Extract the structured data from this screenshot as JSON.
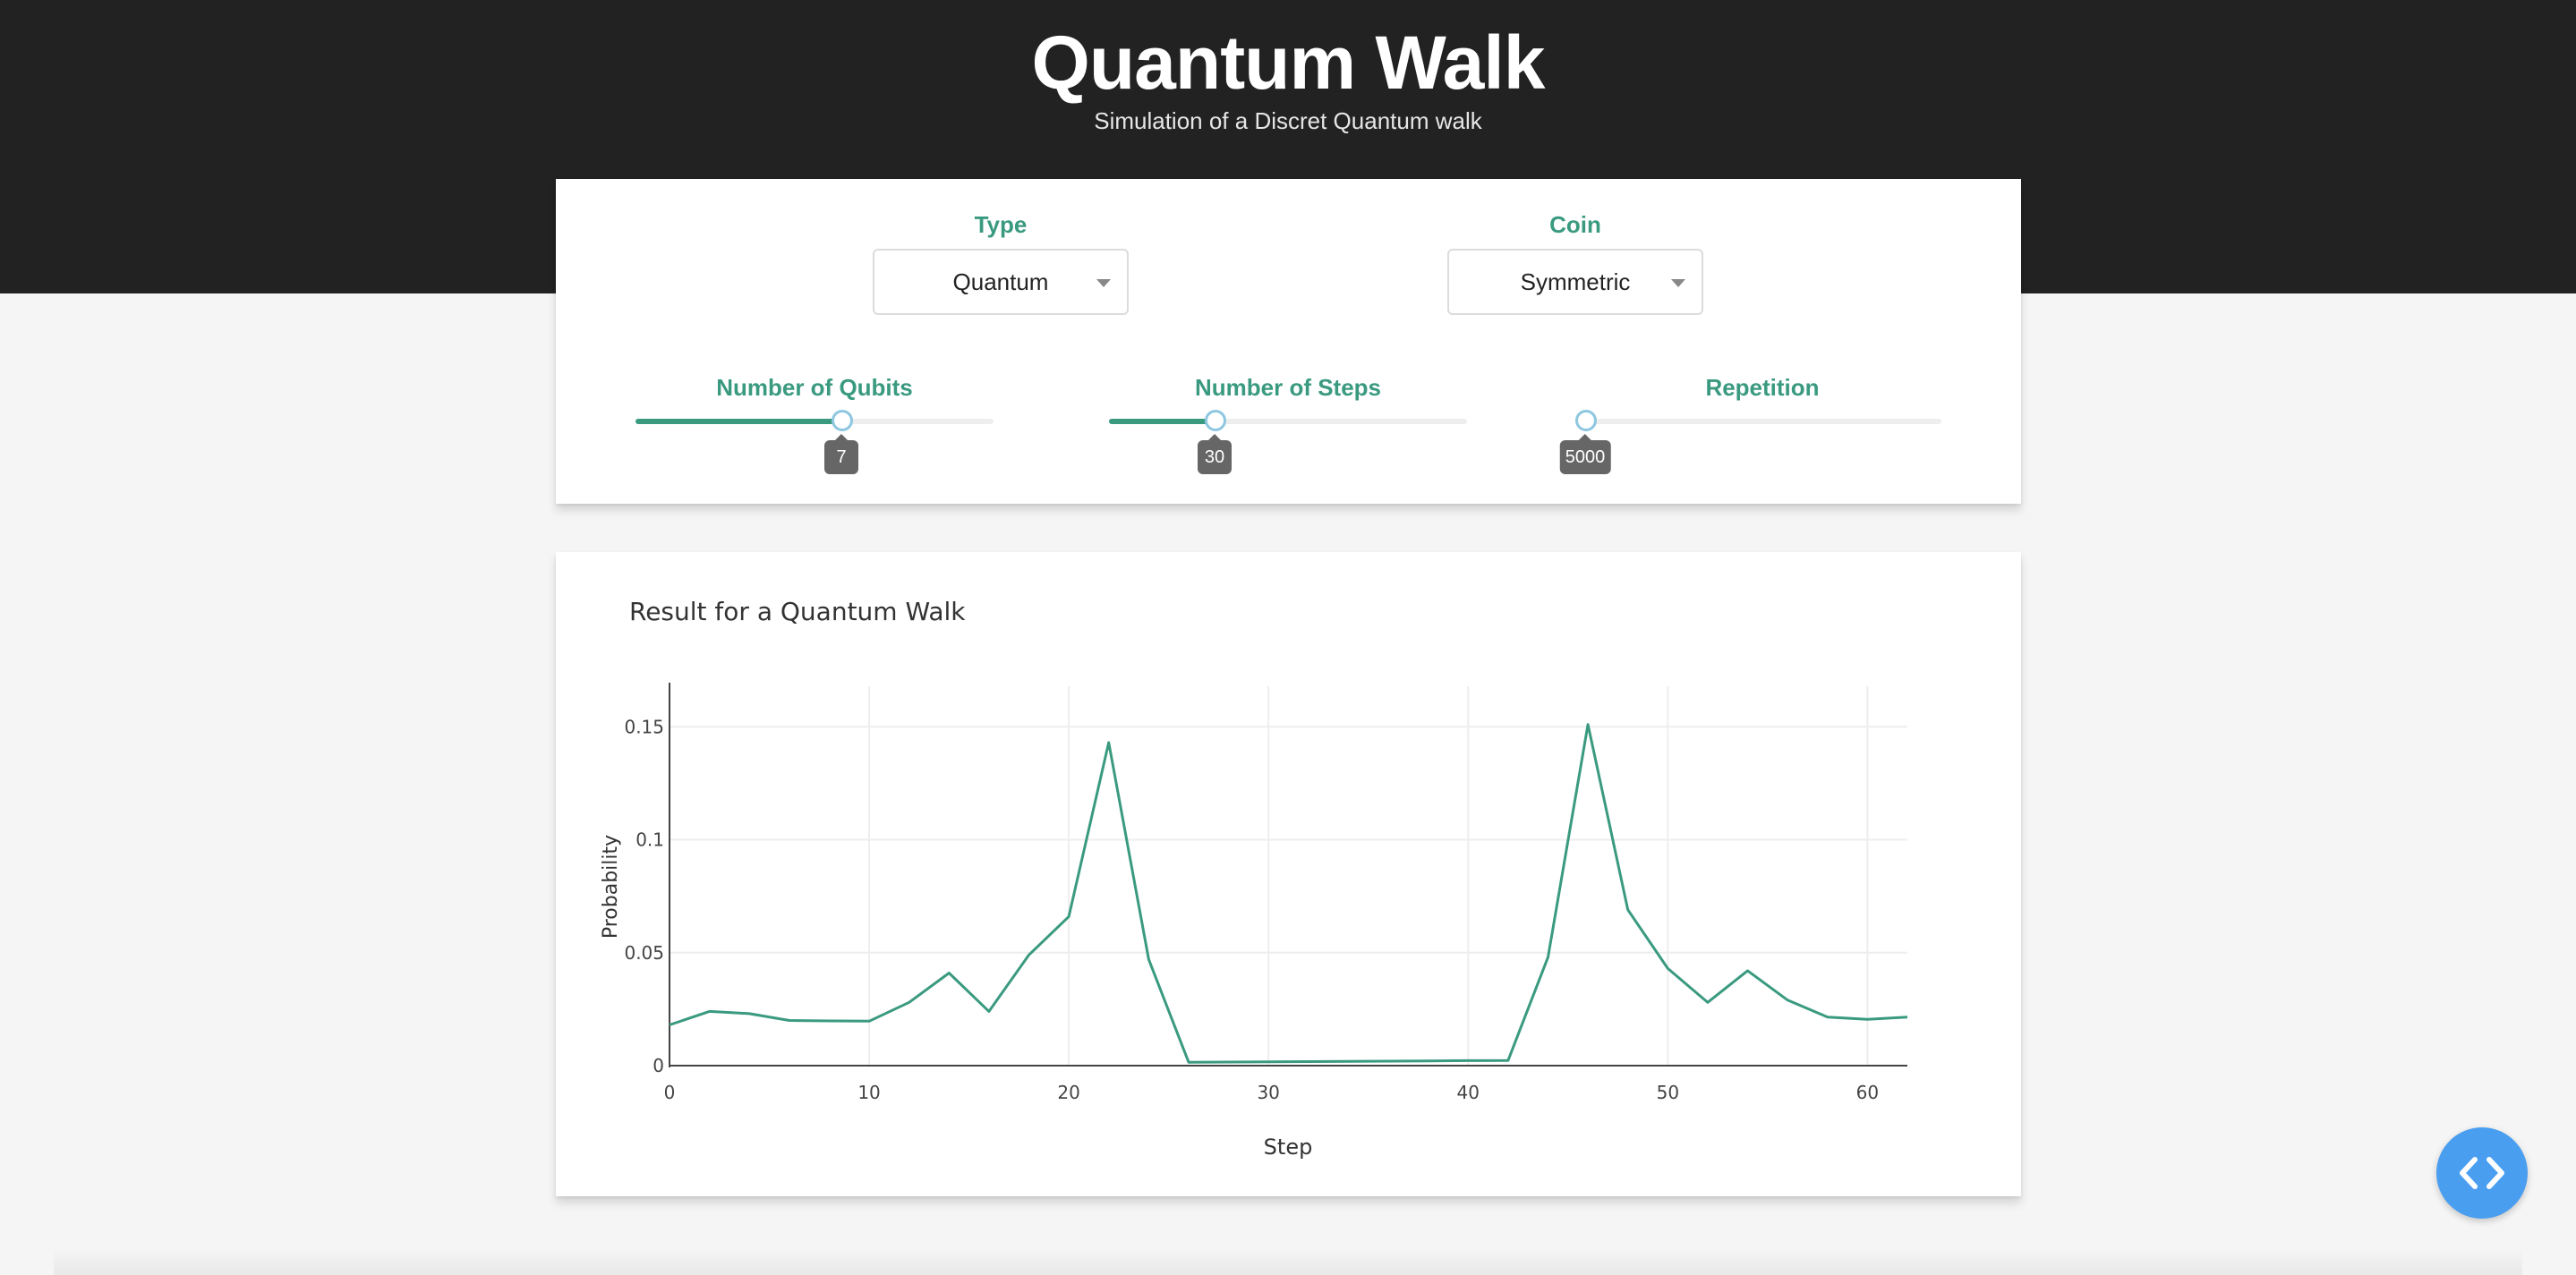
{
  "header": {
    "title": "Quantum Walk",
    "subtitle": "Simulation of a Discret Quantum walk"
  },
  "controls": {
    "type": {
      "label": "Type",
      "value": "Quantum"
    },
    "coin": {
      "label": "Coin",
      "value": "Symmetric"
    },
    "qubits": {
      "label": "Number of Qubits",
      "value": "7",
      "level": 0.57
    },
    "steps": {
      "label": "Number of Steps",
      "value": "30",
      "level": 0.29
    },
    "repetition": {
      "label": "Repetition",
      "value": "5000",
      "level": 0.0
    }
  },
  "colors": {
    "accent": "#3a9a80",
    "header_bg": "#222222",
    "fab": "#4a9ef0"
  },
  "fab": {
    "icon": "code-icon"
  },
  "chart_data": {
    "type": "line",
    "title": "Result for a Quantum Walk",
    "xlabel": "Step",
    "ylabel": "Probability",
    "xlim": [
      0,
      62
    ],
    "ylim": [
      0,
      0.16
    ],
    "xticks": [
      "0",
      "10",
      "20",
      "30",
      "40",
      "50",
      "60"
    ],
    "yticks": [
      "0",
      "0.05",
      "0.1",
      "0.15"
    ],
    "grid": true,
    "series": [
      {
        "color": "#3a9a80",
        "x": [
          0,
          2,
          4,
          6,
          8,
          10,
          12,
          14,
          16,
          18,
          20,
          22,
          24,
          26,
          28,
          30,
          32,
          34,
          36,
          38,
          40,
          42,
          44,
          46,
          48,
          50,
          52,
          54,
          56,
          58,
          60,
          62
        ],
        "y": [
          0.018,
          0.024,
          0.023,
          0.02,
          0.0198,
          0.0197,
          0.028,
          0.041,
          0.024,
          0.049,
          0.066,
          0.143,
          0.047,
          0.0015,
          0.0016,
          0.0017,
          0.0018,
          0.0019,
          0.002,
          0.0021,
          0.0022,
          0.0023,
          0.048,
          0.151,
          0.069,
          0.043,
          0.028,
          0.042,
          0.029,
          0.0215,
          0.0205,
          0.0215
        ]
      }
    ]
  }
}
